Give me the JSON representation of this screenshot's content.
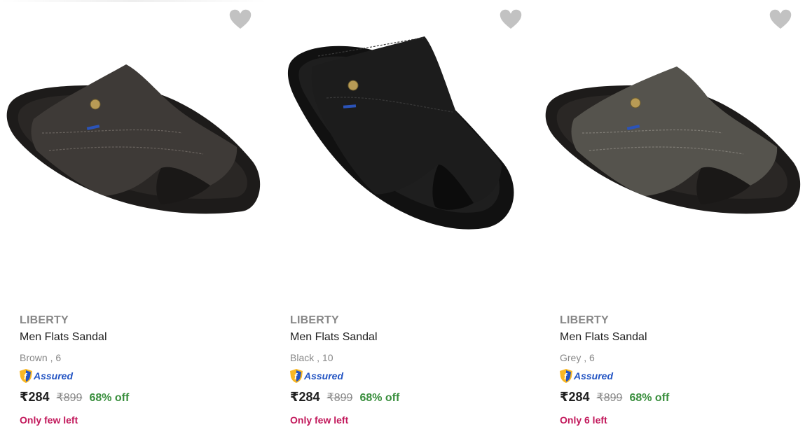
{
  "products": [
    {
      "brand": "LIBERTY",
      "title": "Men Flats Sandal",
      "variant": "Brown , 6",
      "assured_label": "Assured",
      "price": "₹284",
      "mrp": "₹899",
      "discount": "68% off",
      "stock": "Only few left",
      "shoe_color": "#3e3a37"
    },
    {
      "brand": "LIBERTY",
      "title": "Men Flats Sandal",
      "variant": "Black , 10",
      "assured_label": "Assured",
      "price": "₹284",
      "mrp": "₹899",
      "discount": "68% off",
      "stock": "Only few left",
      "shoe_color": "#1c1c1c"
    },
    {
      "brand": "LIBERTY",
      "title": "Men Flats Sandal",
      "variant": "Grey , 6",
      "assured_label": "Assured",
      "price": "₹284",
      "mrp": "₹899",
      "discount": "68% off",
      "stock": "Only 6 left",
      "shoe_color": "#55534d"
    }
  ],
  "colors": {
    "brand_text": "#878787",
    "discount_green": "#388e3c",
    "stock_pink": "#c2185b",
    "assured_blue": "#2455c3",
    "wishlist_grey": "#c2c2c2"
  },
  "icons": {
    "wishlist": "heart-icon",
    "assured": "assured-shield-icon"
  }
}
